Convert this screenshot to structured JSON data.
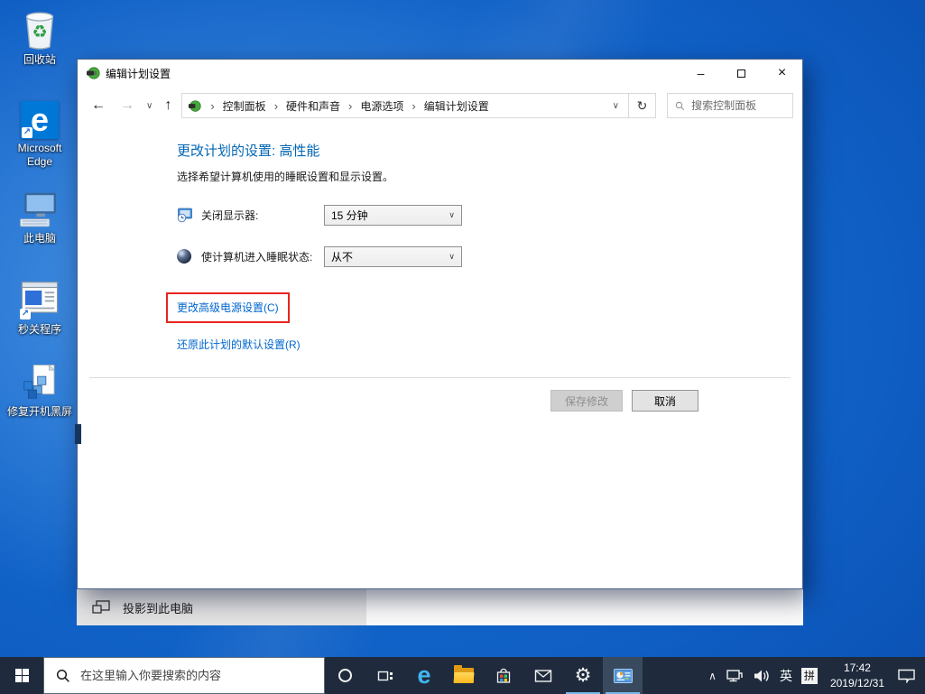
{
  "icons": {
    "back": "←",
    "forward": "→",
    "up": "↑",
    "chevron_down": "∨",
    "refresh": "↻",
    "crumb_sep": "›",
    "minimize": "–",
    "close": "×",
    "tray_chevron": "∧",
    "gear": "⚙",
    "recycle_symbol": "♻",
    "shortcut_arrow": "↗",
    "edge_letter": "e"
  },
  "desktop": {
    "icons": [
      {
        "label": "回收站"
      },
      {
        "label": "Microsoft Edge"
      },
      {
        "label": "此电脑"
      },
      {
        "label": "秒关程序"
      },
      {
        "label": "修复开机黑屏"
      }
    ]
  },
  "window": {
    "title": "编辑计划设置",
    "breadcrumb": [
      "控制面板",
      "硬件和声音",
      "电源选项",
      "编辑计划设置"
    ],
    "search_placeholder": "搜索控制面板",
    "content": {
      "heading": "更改计划的设置: 高性能",
      "description": "选择希望计算机使用的睡眠设置和显示设置。",
      "settings": [
        {
          "label": "关闭显示器:",
          "value": "15 分钟"
        },
        {
          "label": "使计算机进入睡眠状态:",
          "value": "从不"
        }
      ],
      "links": [
        {
          "label": "更改高级电源设置(C)"
        },
        {
          "label": "还原此计划的默认设置(R)"
        }
      ],
      "save_label": "保存修改",
      "cancel_label": "取消"
    }
  },
  "background_window": {
    "item_label": "投影到此电脑"
  },
  "taskbar": {
    "search_placeholder": "在这里输入你要搜索的内容",
    "tray": {
      "language": "英",
      "ime": "拼",
      "time": "17:42",
      "date": "2019/12/31"
    }
  },
  "colors": {
    "heading_blue": "#0066b4",
    "link_blue": "#0066cc",
    "highlight_red": "#e8251f",
    "taskbar_bg": "#1f2b3c",
    "run_indicator": "#76b9ed"
  }
}
